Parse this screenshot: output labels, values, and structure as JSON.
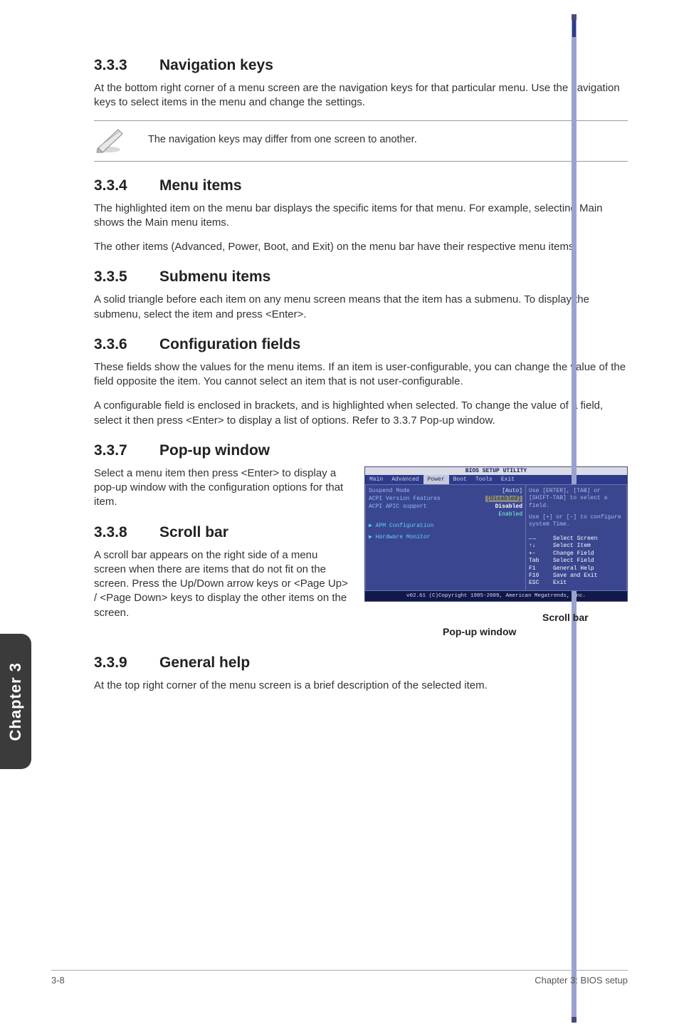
{
  "sections": {
    "s333": {
      "num": "3.3.3",
      "title": "Navigation keys",
      "p1": "At the bottom right corner of a menu screen are the navigation keys for that particular menu. Use the navigation keys to select items in the menu and change the settings."
    },
    "note": "The navigation keys may differ from one screen to another.",
    "s334": {
      "num": "3.3.4",
      "title": "Menu items",
      "p1": "The highlighted item on the menu bar displays the specific items for that menu. For example, selecting Main shows the Main menu items.",
      "p2": "The other items (Advanced, Power, Boot, and Exit) on the menu bar have their respective menu items."
    },
    "s335": {
      "num": "3.3.5",
      "title": "Submenu items",
      "p1": "A solid triangle before each item on any menu screen means that the item has a submenu. To display the submenu, select the item and press <Enter>."
    },
    "s336": {
      "num": "3.3.6",
      "title": "Configuration fields",
      "p1": "These fields show the values for the menu items. If an item is user-configurable, you can change the value of the field opposite the item. You cannot select an item that is not user-configurable.",
      "p2": "A configurable field is enclosed in brackets, and is highlighted when selected. To change the value of a field, select it then press <Enter> to display a list of options. Refer to 3.3.7 Pop-up window."
    },
    "s337": {
      "num": "3.3.7",
      "title": "Pop-up window",
      "p1": "Select a menu item then press <Enter> to display a pop-up window with the configuration options for that item."
    },
    "s338": {
      "num": "3.3.8",
      "title": "Scroll bar",
      "p1": "A scroll bar appears on the right side of a menu screen when there are items that do not fit on the screen. Press the Up/Down arrow keys or <Page Up> / <Page Down> keys to display the other items on the screen."
    },
    "s339": {
      "num": "3.3.9",
      "title": "General help",
      "p1": "At the top right corner of the menu screen is a brief description of the selected item."
    }
  },
  "bios": {
    "title": "BIOS SETUP UTILITY",
    "tabs": [
      "Main",
      "Advanced",
      "Power",
      "Boot",
      "Tools",
      "Exit"
    ],
    "active_tab": "Power",
    "rows": [
      {
        "label": "Suspend Mode",
        "value": "[Auto]"
      },
      {
        "label": "ACPI Version Features",
        "value": "[Disabled]"
      },
      {
        "label": "ACPI APIC support",
        "value": "Disabled"
      },
      {
        "label": "",
        "value": "Enabled"
      }
    ],
    "subs": [
      "APM Configuration",
      "Hardware Monitor"
    ],
    "help1": "Use [ENTER], [TAB] or [SHIFT-TAB] to select a field.",
    "help2": "Use [+] or [-] to configure system Time.",
    "keys": [
      {
        "k": "←→",
        "d": "Select Screen"
      },
      {
        "k": "↑↓",
        "d": "Select Item"
      },
      {
        "k": "+-",
        "d": "Change Field"
      },
      {
        "k": "Tab",
        "d": "Select Field"
      },
      {
        "k": "F1",
        "d": "General Help"
      },
      {
        "k": "F10",
        "d": "Save and Exit"
      },
      {
        "k": "ESC",
        "d": "Exit"
      }
    ],
    "footer": "v02.61 (C)Copyright 1985-2009, American Megatrends, Inc."
  },
  "callouts": {
    "scroll": "Scroll bar",
    "popup": "Pop-up window"
  },
  "sideTab": "Chapter 3",
  "footer": {
    "left": "3-8",
    "right": "Chapter 3: BIOS setup"
  }
}
